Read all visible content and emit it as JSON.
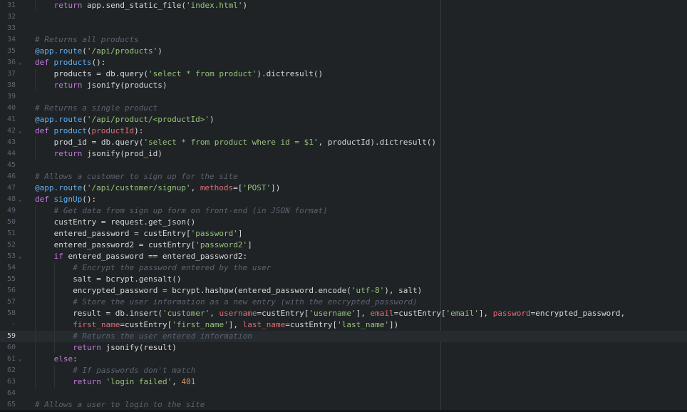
{
  "editor": {
    "current_line": "59",
    "lines": [
      {
        "num": "31",
        "fold": false,
        "indent": 1,
        "tokens": [
          [
            "k",
            "return"
          ],
          [
            "t",
            " app.send_static_file("
          ],
          [
            "s",
            "'index.html'"
          ],
          [
            "t",
            ")"
          ]
        ]
      },
      {
        "num": "32",
        "fold": false,
        "indent": 0,
        "tokens": []
      },
      {
        "num": "33",
        "fold": false,
        "indent": 0,
        "tokens": []
      },
      {
        "num": "34",
        "fold": false,
        "indent": 0,
        "tokens": [
          [
            "c",
            "# Returns all products"
          ]
        ]
      },
      {
        "num": "35",
        "fold": false,
        "indent": 0,
        "tokens": [
          [
            "f",
            "@app.route"
          ],
          [
            "t",
            "("
          ],
          [
            "s",
            "'/api/products'"
          ],
          [
            "t",
            ")"
          ]
        ]
      },
      {
        "num": "36",
        "fold": true,
        "indent": 0,
        "tokens": [
          [
            "k",
            "def"
          ],
          [
            "t",
            " "
          ],
          [
            "f",
            "products"
          ],
          [
            "t",
            "():"
          ]
        ]
      },
      {
        "num": "37",
        "fold": false,
        "indent": 1,
        "tokens": [
          [
            "t",
            "products = db.query("
          ],
          [
            "s",
            "'select * from product'"
          ],
          [
            "t",
            ").dictresult()"
          ]
        ]
      },
      {
        "num": "38",
        "fold": false,
        "indent": 1,
        "tokens": [
          [
            "k",
            "return"
          ],
          [
            "t",
            " jsonify(products)"
          ]
        ]
      },
      {
        "num": "39",
        "fold": false,
        "indent": 0,
        "tokens": []
      },
      {
        "num": "40",
        "fold": false,
        "indent": 0,
        "tokens": [
          [
            "c",
            "# Returns a single product"
          ]
        ]
      },
      {
        "num": "41",
        "fold": false,
        "indent": 0,
        "tokens": [
          [
            "f",
            "@app.route"
          ],
          [
            "t",
            "("
          ],
          [
            "s",
            "'/api/product/<productId>'"
          ],
          [
            "t",
            ")"
          ]
        ]
      },
      {
        "num": "42",
        "fold": true,
        "indent": 0,
        "tokens": [
          [
            "k",
            "def"
          ],
          [
            "t",
            " "
          ],
          [
            "f",
            "product"
          ],
          [
            "t",
            "("
          ],
          [
            "a",
            "productId"
          ],
          [
            "t",
            "):"
          ]
        ]
      },
      {
        "num": "43",
        "fold": false,
        "indent": 1,
        "tokens": [
          [
            "t",
            "prod_id = db.query("
          ],
          [
            "s",
            "'select * from product where id = $1'"
          ],
          [
            "t",
            ", productId).dictresult()"
          ]
        ]
      },
      {
        "num": "44",
        "fold": false,
        "indent": 1,
        "tokens": [
          [
            "k",
            "return"
          ],
          [
            "t",
            " jsonify(prod_id)"
          ]
        ]
      },
      {
        "num": "45",
        "fold": false,
        "indent": 0,
        "tokens": []
      },
      {
        "num": "46",
        "fold": false,
        "indent": 0,
        "tokens": [
          [
            "c",
            "# Allows a customer to sign up for the site"
          ]
        ]
      },
      {
        "num": "47",
        "fold": false,
        "indent": 0,
        "tokens": [
          [
            "f",
            "@app.route"
          ],
          [
            "t",
            "("
          ],
          [
            "s",
            "'/api/customer/signup'"
          ],
          [
            "t",
            ", "
          ],
          [
            "a",
            "methods"
          ],
          [
            "t",
            "=["
          ],
          [
            "s",
            "'POST'"
          ],
          [
            "t",
            "])"
          ]
        ]
      },
      {
        "num": "48",
        "fold": true,
        "indent": 0,
        "tokens": [
          [
            "k",
            "def"
          ],
          [
            "t",
            " "
          ],
          [
            "f",
            "signUp"
          ],
          [
            "t",
            "():"
          ]
        ]
      },
      {
        "num": "49",
        "fold": false,
        "indent": 1,
        "tokens": [
          [
            "c",
            "# Get data from sign up form on front-end (in JSON format)"
          ]
        ]
      },
      {
        "num": "50",
        "fold": false,
        "indent": 1,
        "tokens": [
          [
            "t",
            "custEntry = request.get_json()"
          ]
        ]
      },
      {
        "num": "51",
        "fold": false,
        "indent": 1,
        "tokens": [
          [
            "t",
            "entered_password = custEntry["
          ],
          [
            "s",
            "'password'"
          ],
          [
            "t",
            "]"
          ]
        ]
      },
      {
        "num": "52",
        "fold": false,
        "indent": 1,
        "tokens": [
          [
            "t",
            "entered_password2 = custEntry["
          ],
          [
            "s",
            "'password2'"
          ],
          [
            "t",
            "]"
          ]
        ]
      },
      {
        "num": "53",
        "fold": true,
        "indent": 1,
        "tokens": [
          [
            "k",
            "if"
          ],
          [
            "t",
            " entered_password == entered_password2:"
          ]
        ]
      },
      {
        "num": "54",
        "fold": false,
        "indent": 2,
        "tokens": [
          [
            "c",
            "# Encrypt the password entered by the user"
          ]
        ]
      },
      {
        "num": "55",
        "fold": false,
        "indent": 2,
        "tokens": [
          [
            "t",
            "salt = bcrypt.gensalt()"
          ]
        ]
      },
      {
        "num": "56",
        "fold": false,
        "indent": 2,
        "tokens": [
          [
            "t",
            "encrypted_password = bcrypt.hashpw(entered_password.encode("
          ],
          [
            "s",
            "'utf-8'"
          ],
          [
            "t",
            "), salt)"
          ]
        ]
      },
      {
        "num": "57",
        "fold": false,
        "indent": 2,
        "tokens": [
          [
            "c",
            "# Store the user information as a new entry (with the encrypted_password)"
          ]
        ]
      },
      {
        "num": "58",
        "fold": false,
        "indent": 2,
        "tokens": [
          [
            "t",
            "result = db.insert("
          ],
          [
            "s",
            "'customer'"
          ],
          [
            "t",
            ", "
          ],
          [
            "a",
            "username"
          ],
          [
            "t",
            "=custEntry["
          ],
          [
            "s",
            "'username'"
          ],
          [
            "t",
            "], "
          ],
          [
            "a",
            "email"
          ],
          [
            "t",
            "=custEntry["
          ],
          [
            "s",
            "'email'"
          ],
          [
            "t",
            "], "
          ],
          [
            "a",
            "password"
          ],
          [
            "t",
            "=encrypted_password,"
          ]
        ]
      },
      {
        "num": "·",
        "fold": false,
        "indent": 2,
        "tokens": [
          [
            "a",
            "first_name"
          ],
          [
            "t",
            "=custEntry["
          ],
          [
            "s",
            "'first_name'"
          ],
          [
            "t",
            "], "
          ],
          [
            "a",
            "last_name"
          ],
          [
            "t",
            "=custEntry["
          ],
          [
            "s",
            "'last_name'"
          ],
          [
            "t",
            "])"
          ]
        ]
      },
      {
        "num": "59",
        "fold": false,
        "indent": 2,
        "tokens": [
          [
            "c",
            "# Returns the user entered information"
          ]
        ]
      },
      {
        "num": "60",
        "fold": false,
        "indent": 2,
        "tokens": [
          [
            "k",
            "return"
          ],
          [
            "t",
            " jsonify(result)"
          ]
        ]
      },
      {
        "num": "61",
        "fold": true,
        "indent": 1,
        "tokens": [
          [
            "k",
            "else"
          ],
          [
            "t",
            ":"
          ]
        ]
      },
      {
        "num": "62",
        "fold": false,
        "indent": 2,
        "tokens": [
          [
            "c",
            "# If passwords don't match"
          ]
        ]
      },
      {
        "num": "63",
        "fold": false,
        "indent": 2,
        "tokens": [
          [
            "k",
            "return"
          ],
          [
            "t",
            " "
          ],
          [
            "s",
            "'login failed'"
          ],
          [
            "t",
            ", "
          ],
          [
            "n",
            "401"
          ]
        ]
      },
      {
        "num": "64",
        "fold": false,
        "indent": 0,
        "tokens": []
      },
      {
        "num": "65",
        "fold": false,
        "indent": 0,
        "tokens": [
          [
            "c",
            "# Allows a user to login to the site"
          ]
        ]
      }
    ]
  },
  "icons": {
    "fold": "chevron-down-icon"
  },
  "colors": {
    "background": "#1f2326",
    "keyword": "#c678dd",
    "function": "#61afef",
    "string": "#98c379",
    "comment": "#5c6370",
    "number": "#d19a66",
    "parameter": "#e06c75"
  }
}
